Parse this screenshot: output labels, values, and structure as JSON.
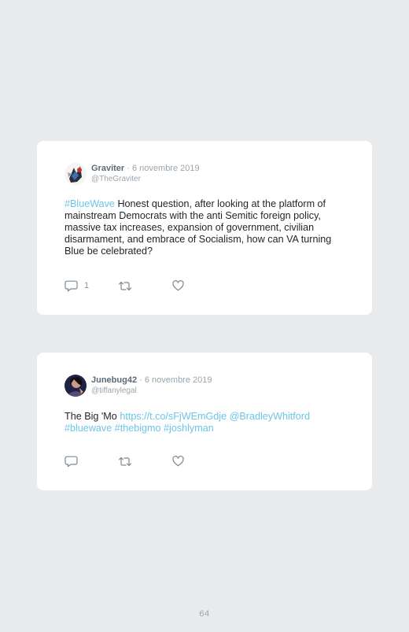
{
  "tweets": [
    {
      "name": "Graviter",
      "separator": "·",
      "date": "6 novembre 2019",
      "handle": "@TheGraviter",
      "text": {
        "hashtag": "#BlueWave",
        "body": "Honest question, after looking at the platform of mainstream Democrats with the anti Semitic foreign policy, massive tax increases, expansion of government, civilian disarmament, and embrace of Socialism, how can VA turning Blue be celebrated?"
      },
      "reply_count": "1",
      "icons": {
        "reply": "reply-icon",
        "retweet": "retweet-icon",
        "like": "heart-icon"
      }
    },
    {
      "name": "Junebug42",
      "separator": "·",
      "date": "6 novembre 2019",
      "handle": "@tiffanylegal",
      "text": {
        "body": "The Big 'Mo",
        "url": "https://t.co/sFjWEmGdje",
        "mention": "@BradleyWhitford",
        "hashtags": [
          "#bluewave",
          "#thebigmo",
          "#joshlyman"
        ]
      },
      "reply_count": "",
      "icons": {
        "reply": "reply-icon",
        "retweet": "retweet-icon",
        "like": "heart-icon"
      }
    }
  ],
  "page_number": "64",
  "colors": {
    "background": "#e8eaeb",
    "card": "#ffffff",
    "link": "#6cc5e8",
    "name": "#5c6a77",
    "muted": "#9aa5ae"
  }
}
